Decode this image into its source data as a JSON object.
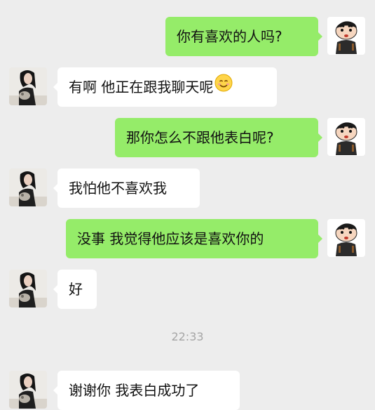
{
  "colors": {
    "background": "#ededed",
    "sent_bubble": "#95ec69",
    "received_bubble": "#ffffff",
    "timestamp_text": "#a5a5a5"
  },
  "messages": [
    {
      "side": "right",
      "text": "你有喜欢的人吗?"
    },
    {
      "side": "left",
      "text": "有啊 他正在跟我聊天呢",
      "emoji": "smiling-face-emoji"
    },
    {
      "side": "right",
      "text": "那你怎么不跟他表白呢?"
    },
    {
      "side": "left",
      "text": "我怕他不喜欢我"
    },
    {
      "side": "right",
      "text": "没事 我觉得他应该是喜欢你的"
    },
    {
      "side": "left",
      "text": "好"
    },
    {
      "side": "left",
      "text": "谢谢你 我表白成功了"
    }
  ],
  "timestamp": "22:33"
}
